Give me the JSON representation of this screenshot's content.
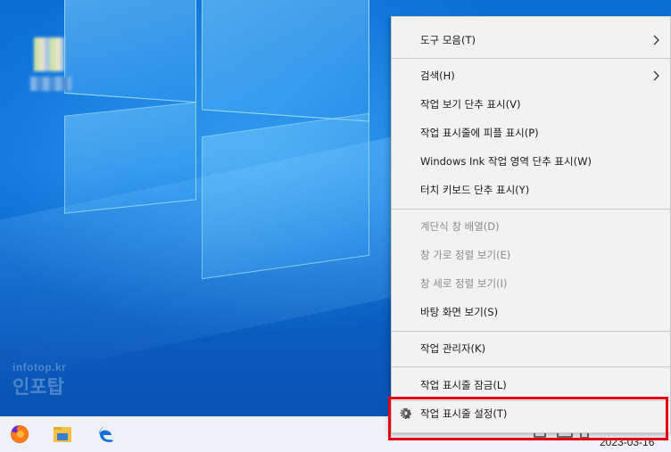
{
  "desktop": {
    "watermark_top": "infotop.kr",
    "watermark_bottom": "인포탑"
  },
  "taskbar": {
    "apps": [
      "firefox-icon",
      "file-explorer-icon",
      "edge-icon"
    ],
    "clock": "2023-03-16"
  },
  "menu": {
    "items": [
      {
        "label": "도구 모음(T)"
      },
      {
        "label": "검색(H)"
      },
      {
        "label": "작업 보기 단추 표시(V)"
      },
      {
        "label": "작업 표시줄에 피플 표시(P)"
      },
      {
        "label": "Windows Ink 작업 영역 단추 표시(W)"
      },
      {
        "label": "터치 키보드 단추 표시(Y)"
      },
      {
        "label": "계단식 창 배열(D)"
      },
      {
        "label": "창 가로 정렬 보기(E)"
      },
      {
        "label": "창 세로 정렬 보기(I)"
      },
      {
        "label": "바탕 화면 보기(S)"
      },
      {
        "label": "작업 관리자(K)"
      },
      {
        "label": "작업 표시줄 잠금(L)"
      },
      {
        "label": "작업 표시줄 설정(T)"
      }
    ]
  },
  "colors": {
    "highlight": "#e60012",
    "menu_bg": "#f2f2f2",
    "desktop": "#0a63c9"
  }
}
